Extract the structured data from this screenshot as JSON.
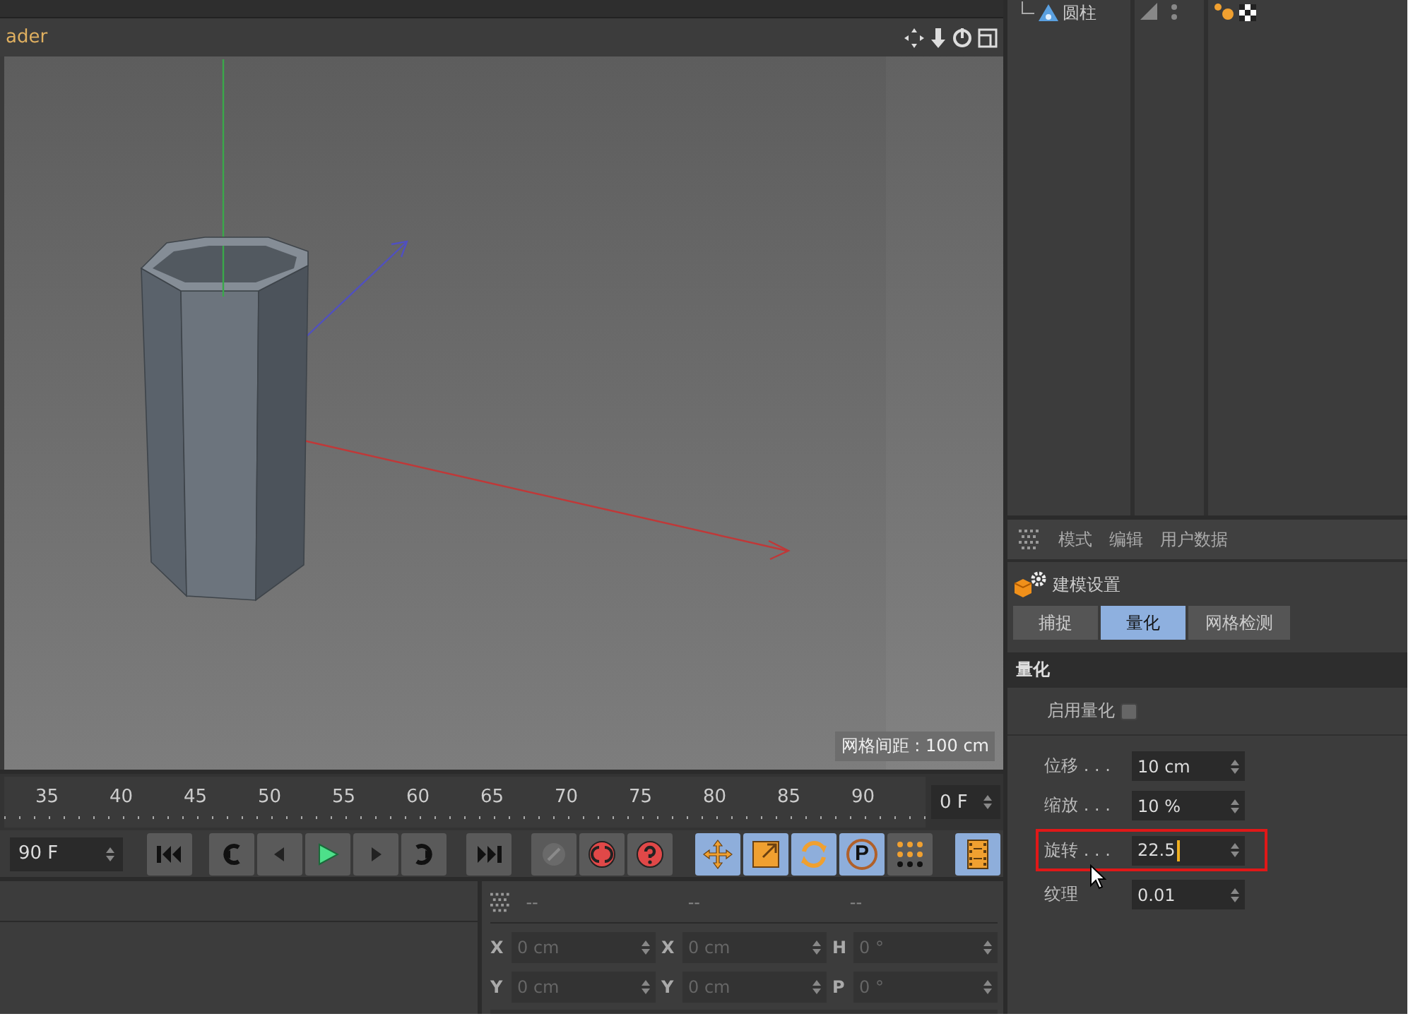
{
  "object_manager": {
    "items": [
      {
        "name": "圆柱"
      }
    ]
  },
  "viewport": {
    "title": "ader",
    "grid_spacing": "网格间距 : 100 cm"
  },
  "timeline": {
    "ticks": [
      "35",
      "40",
      "45",
      "50",
      "55",
      "60",
      "65",
      "70",
      "75",
      "80",
      "85",
      "90"
    ],
    "current_frame": "0 F",
    "end_frame": "90 F"
  },
  "tools": [
    {
      "kind": "move",
      "on": true
    },
    {
      "kind": "scale",
      "on": true
    },
    {
      "kind": "rotate",
      "on": true
    },
    {
      "kind": "param",
      "label": "P",
      "on": true
    },
    {
      "kind": "points",
      "on": false
    }
  ],
  "film_button": {
    "on": true
  },
  "coordinates": {
    "headers": [
      "--",
      "--",
      "--"
    ],
    "rows": [
      [
        {
          "axis": "X",
          "value": "0 cm",
          "disabled": true
        },
        {
          "axis": "X",
          "value": "0 cm",
          "disabled": true
        },
        {
          "axis": "H",
          "value": "0 °",
          "disabled": true
        }
      ],
      [
        {
          "axis": "Y",
          "value": "0 cm",
          "disabled": true
        },
        {
          "axis": "Y",
          "value": "0 cm",
          "disabled": true
        },
        {
          "axis": "P",
          "value": "0 °",
          "disabled": true
        }
      ]
    ]
  },
  "attributes": {
    "menu": [
      "模式",
      "编辑",
      "用户数据"
    ],
    "title": "建模设置",
    "tabs": [
      {
        "label": "捕捉",
        "selected": false
      },
      {
        "label": "量化",
        "selected": true
      },
      {
        "label": "网格检测",
        "selected": false
      }
    ],
    "section": "量化",
    "enable": {
      "label": "启用量化",
      "checked": false
    },
    "fields": [
      {
        "label": "位移 . . .",
        "value": "10 cm",
        "highlighted": false,
        "editing": false
      },
      {
        "label": "缩放 . . .",
        "value": "10 %",
        "highlighted": false,
        "editing": false
      },
      {
        "label": "旋转 . . .",
        "value": "22.5",
        "highlighted": true,
        "editing": true
      },
      {
        "label": "纹理",
        "value": "0.01",
        "highlighted": false,
        "editing": false
      }
    ]
  }
}
